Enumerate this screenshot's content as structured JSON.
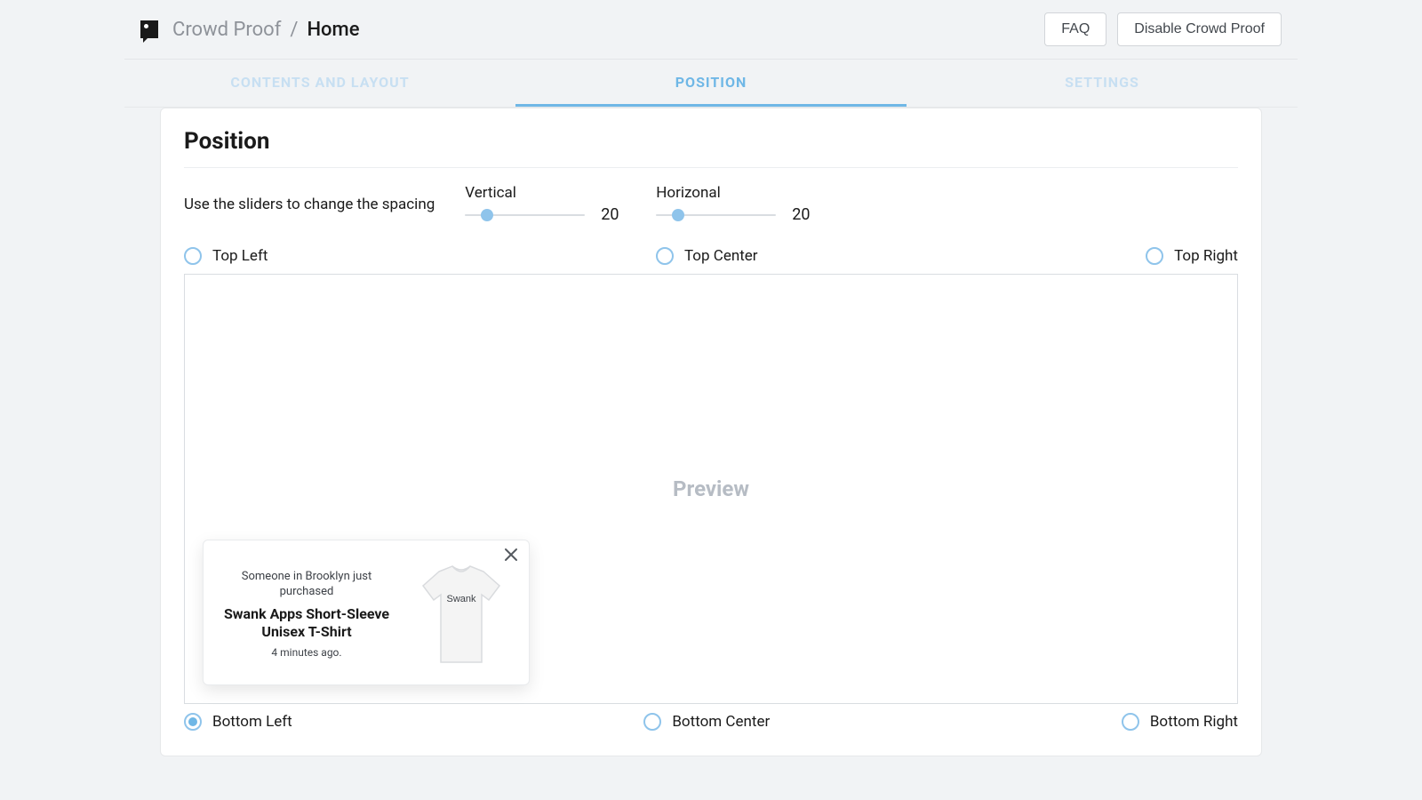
{
  "header": {
    "app_name": "Crowd Proof",
    "separator": "/",
    "page": "Home",
    "faq_label": "FAQ",
    "disable_label": "Disable Crowd Proof"
  },
  "tabs": [
    {
      "label": "CONTENTS AND LAYOUT",
      "active": false
    },
    {
      "label": "POSITION",
      "active": true
    },
    {
      "label": "SETTINGS",
      "active": false
    }
  ],
  "position": {
    "title": "Position",
    "sliders_instruction": "Use the sliders to change the spacing",
    "vertical_label": "Vertical",
    "vertical_value": "20",
    "horizontal_label": "Horizonal",
    "horizontal_value": "20"
  },
  "radios": {
    "top_left": "Top Left",
    "top_center": "Top Center",
    "top_right": "Top Right",
    "bottom_left": "Bottom Left",
    "bottom_center": "Bottom Center",
    "bottom_right": "Bottom Right",
    "selected": "bottom_left"
  },
  "preview": {
    "label": "Preview"
  },
  "notification": {
    "lead": "Someone in Brooklyn just purchased",
    "product": "Swank Apps Short-Sleeve Unisex T-Shirt",
    "time": "4 minutes ago.",
    "shirt_text": "Swank"
  }
}
